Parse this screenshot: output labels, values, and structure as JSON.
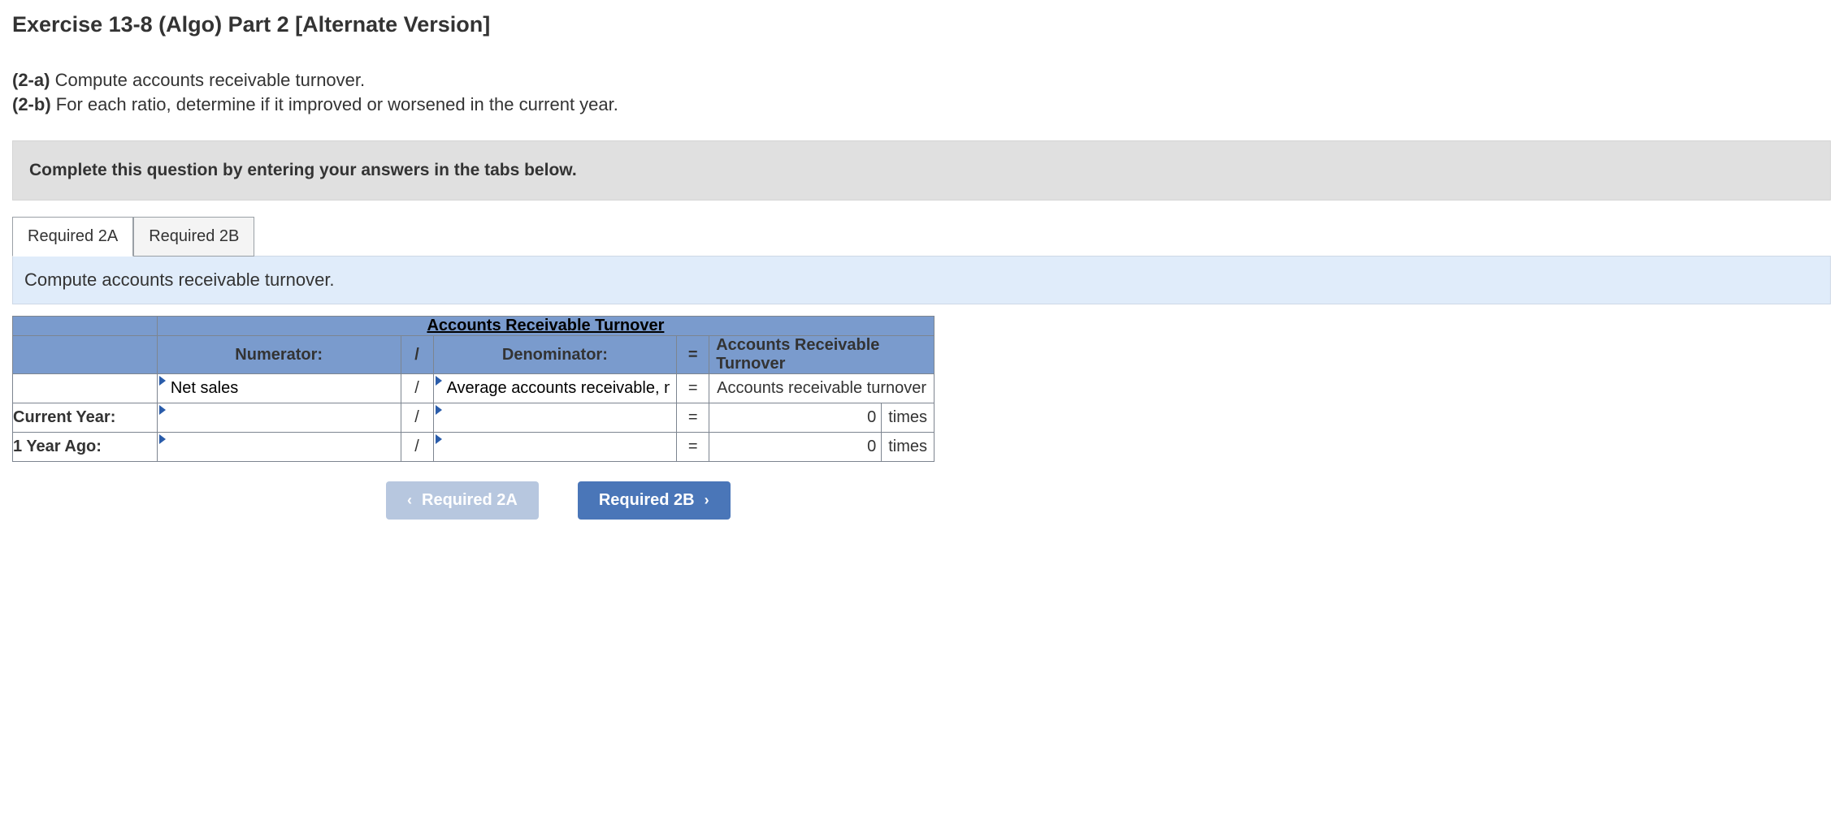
{
  "title": "Exercise 13-8 (Algo) Part 2 [Alternate Version]",
  "prompts": {
    "a_label": "(2-a)",
    "a_text": "Compute accounts receivable turnover.",
    "b_label": "(2-b)",
    "b_text": "For each ratio, determine if it improved or worsened in the current year."
  },
  "instruction": "Complete this question by entering your answers in the tabs below.",
  "tabs": {
    "tab1": "Required 2A",
    "tab2": "Required 2B"
  },
  "tab_description": "Compute accounts receivable turnover.",
  "table": {
    "title": "Accounts Receivable Turnover",
    "headers": {
      "numerator": "Numerator:",
      "slash": "/",
      "denominator": "Denominator:",
      "equals": "=",
      "result": "Accounts Receivable Turnover"
    },
    "formula_row": {
      "numerator": "Net sales",
      "denominator": "Average accounts receivable, net",
      "result": "Accounts receivable turnover"
    },
    "rows": [
      {
        "label": "Current Year:",
        "numerator": "",
        "denominator": "",
        "result_value": "0",
        "result_unit": "times"
      },
      {
        "label": "1 Year Ago:",
        "numerator": "",
        "denominator": "",
        "result_value": "0",
        "result_unit": "times"
      }
    ]
  },
  "nav": {
    "prev": "Required 2A",
    "next": "Required 2B"
  }
}
